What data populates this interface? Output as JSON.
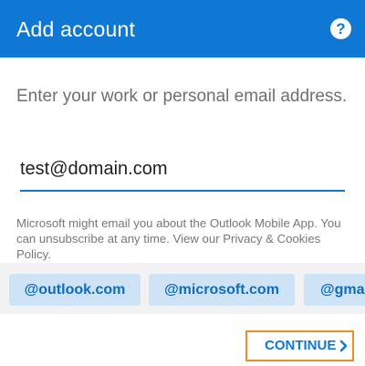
{
  "header": {
    "title": "Add account",
    "help_icon": "question-mark-icon"
  },
  "form": {
    "prompt": "Enter your work or personal email address.",
    "email_value": "test@domain.com",
    "disclaimer": "Microsoft might email you about the Outlook Mobile App. You can unsubscribe at any time. View our Privacy & Cookies Policy."
  },
  "suggestions": [
    {
      "label": "@outlook.com"
    },
    {
      "label": "@microsoft.com"
    },
    {
      "label": "@gmail.com"
    }
  ],
  "footer": {
    "continue_label": "CONTINUE",
    "continue_icon": "chevron-right-icon"
  },
  "colors": {
    "accent": "#0f78d4",
    "chip_background": "#cfe3f7",
    "focus_outline": "#f28c28"
  }
}
